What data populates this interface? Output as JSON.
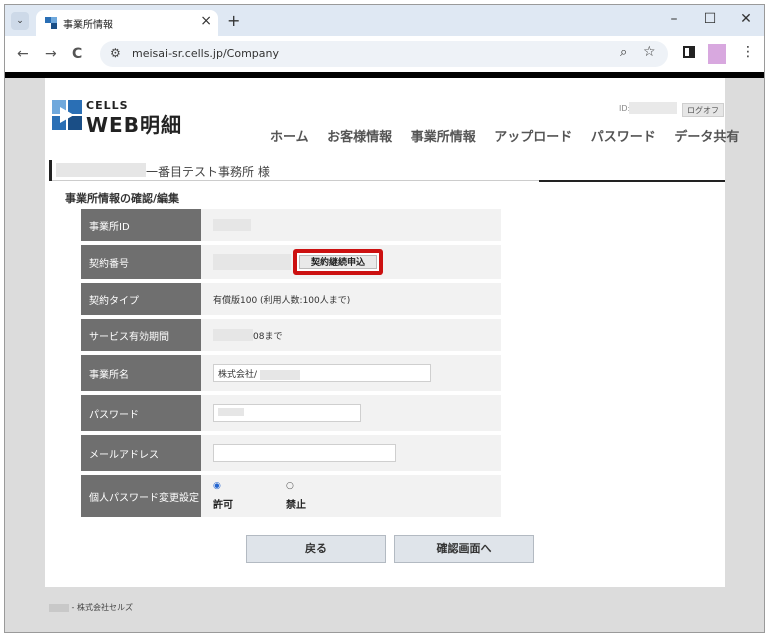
{
  "browser": {
    "tab_title": "事業所情報",
    "tab_close": "×",
    "new_tab": "+",
    "minimize": "–",
    "maximize": "☐",
    "close": "✕",
    "back": "←",
    "forward": "→",
    "reload": "C",
    "url": "meisai-sr.cells.jp/Company",
    "menu": "⋮"
  },
  "site": {
    "logo_small": "CELLS",
    "logo_main": "WEB明細",
    "id_label": "ID:",
    "logout": "ログオフ",
    "nav": [
      "ホーム",
      "お客様情報",
      "事業所情報",
      "アップロード",
      "パスワード",
      "データ共有"
    ]
  },
  "office": {
    "name": "一番目テスト事務所 様"
  },
  "section_title": "事業所情報の確認/編集",
  "form": {
    "office_id_label": "事業所ID",
    "contract_no_label": "契約番号",
    "contract_button": "契約継続申込",
    "contract_type_label": "契約タイプ",
    "contract_type_value": "有償版100 (利用人数:100人まで)",
    "service_period_label": "サービス有効期間",
    "service_period_value": "08まで",
    "office_name_label": "事業所名",
    "office_name_value": "株式会社/",
    "password_label": "パスワード",
    "email_label": "メールアドレス",
    "email_value": "",
    "personal_pw_label": "個人パスワード変更設定",
    "allow": "許可",
    "deny": "禁止"
  },
  "buttons": {
    "back": "戻る",
    "confirm": "確認画面へ"
  },
  "footer": {
    "text": "- 株式会社セルズ"
  }
}
